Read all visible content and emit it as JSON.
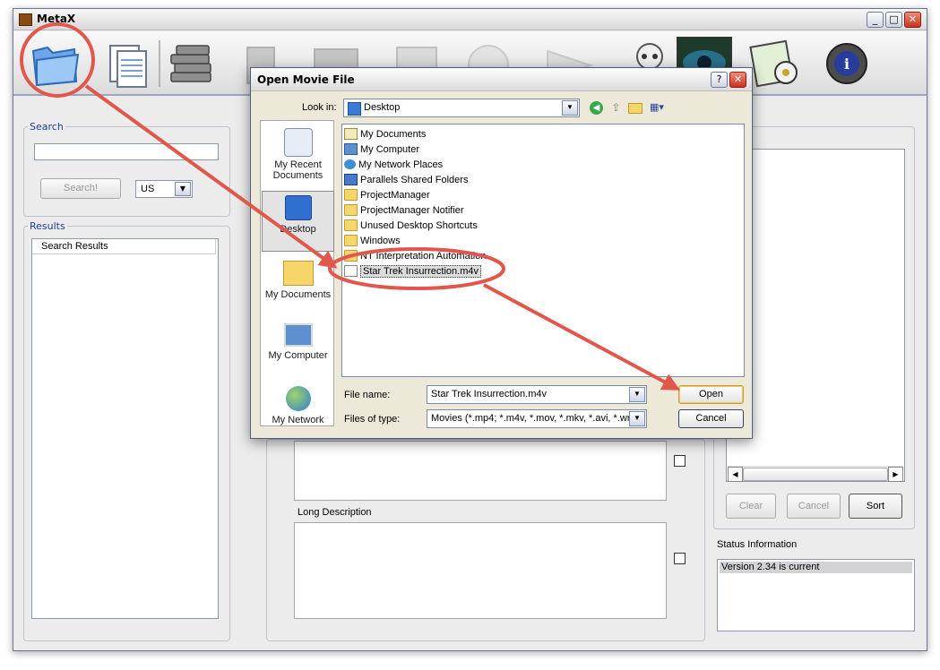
{
  "app": {
    "title": "MetaX"
  },
  "window_buttons": {
    "minimize": "_",
    "maximize": "□",
    "close": "✕"
  },
  "search": {
    "legend": "Search",
    "input_value": "",
    "button": "Search!",
    "country": "US"
  },
  "results": {
    "legend": "Results",
    "header": "Search Results"
  },
  "right_panel": {
    "clear": "Clear",
    "cancel": "Cancel",
    "sort": "Sort",
    "status_label": "Status Information",
    "status_value": "Version 2.34 is current"
  },
  "center": {
    "long_description_label": "Long Description"
  },
  "dialog": {
    "title": "Open Movie File",
    "help": "?",
    "close": "✕",
    "look_in_label": "Look in:",
    "look_in_value": "Desktop",
    "places": [
      {
        "label": "My Recent Documents"
      },
      {
        "label": "Desktop"
      },
      {
        "label": "My Documents"
      },
      {
        "label": "My Computer"
      },
      {
        "label": "My Network"
      }
    ],
    "files": [
      {
        "name": "My Documents",
        "icon": "my-documents"
      },
      {
        "name": "My Computer",
        "icon": "my-computer"
      },
      {
        "name": "My Network Places",
        "icon": "network-places"
      },
      {
        "name": "Parallels Shared Folders",
        "icon": "shared-folder"
      },
      {
        "name": "ProjectManager",
        "icon": "folder"
      },
      {
        "name": "ProjectManager Notifier",
        "icon": "folder"
      },
      {
        "name": "Unused Desktop Shortcuts",
        "icon": "folder"
      },
      {
        "name": "Windows",
        "icon": "folder"
      },
      {
        "name": "NT Interpretation Automation",
        "icon": "folder"
      },
      {
        "name": "Star Trek Insurrection.m4v",
        "icon": "movie-file"
      }
    ],
    "file_name_label": "File name:",
    "file_name_value": "Star Trek Insurrection.m4v",
    "file_type_label": "Files of type:",
    "file_type_value": "Movies (*.mp4; *.m4v, *.mov, *.mkv, *.avi, *.wm",
    "open_button": "Open",
    "cancel_button": "Cancel"
  },
  "annotation_color": "#e2574c"
}
